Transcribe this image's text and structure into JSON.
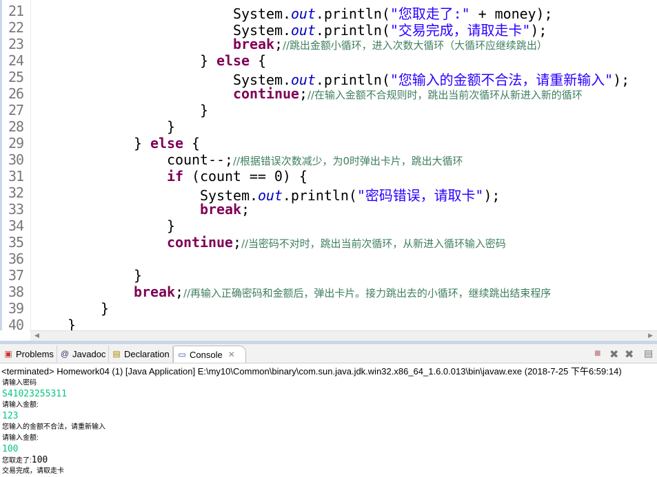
{
  "editor": {
    "line_numbers": [
      "21",
      "22",
      "23",
      "24",
      "25",
      "26",
      "27",
      "28",
      "29",
      "30",
      "31",
      "32",
      "33",
      "34",
      "35",
      "36",
      "37",
      "38",
      "39",
      "40"
    ],
    "lines": [
      {
        "indent": 24,
        "tokens": [
          [
            "p",
            "System."
          ],
          [
            "fld",
            "out"
          ],
          [
            "p",
            ".println("
          ],
          [
            "str",
            "\"您取走了:\""
          ],
          [
            "p",
            " + money);"
          ]
        ]
      },
      {
        "indent": 24,
        "tokens": [
          [
            "p",
            "System."
          ],
          [
            "fld",
            "out"
          ],
          [
            "p",
            ".println("
          ],
          [
            "str",
            "\"交易完成，请取走卡\""
          ],
          [
            "p",
            ");"
          ]
        ]
      },
      {
        "indent": 24,
        "tokens": [
          [
            "kw",
            "break"
          ],
          [
            "p",
            ";"
          ],
          [
            "cm",
            "//跳出金额小循环，进入次数大循环（大循环应继续跳出）"
          ]
        ]
      },
      {
        "indent": 20,
        "tokens": [
          [
            "p",
            "} "
          ],
          [
            "kw",
            "else"
          ],
          [
            "p",
            " {"
          ]
        ]
      },
      {
        "indent": 24,
        "tokens": [
          [
            "p",
            "System."
          ],
          [
            "fld",
            "out"
          ],
          [
            "p",
            ".println("
          ],
          [
            "str",
            "\"您输入的金额不合法，请重新输入\""
          ],
          [
            "p",
            ");"
          ]
        ]
      },
      {
        "indent": 24,
        "tokens": [
          [
            "kw",
            "continue"
          ],
          [
            "p",
            ";"
          ],
          [
            "cm",
            "//在输入金额不合规则时，跳出当前次循环从新进入新的循环"
          ]
        ]
      },
      {
        "indent": 20,
        "tokens": [
          [
            "p",
            "}"
          ]
        ]
      },
      {
        "indent": 16,
        "tokens": [
          [
            "p",
            "}"
          ]
        ]
      },
      {
        "indent": 12,
        "tokens": [
          [
            "p",
            "} "
          ],
          [
            "kw",
            "else"
          ],
          [
            "p",
            " {"
          ]
        ]
      },
      {
        "indent": 16,
        "tokens": [
          [
            "p",
            "count--;"
          ],
          [
            "cm",
            "//根据错误次数减少，为0时弹出卡片，跳出大循环"
          ]
        ]
      },
      {
        "indent": 16,
        "tokens": [
          [
            "kw",
            "if"
          ],
          [
            "p",
            " (count == 0) {"
          ]
        ]
      },
      {
        "indent": 20,
        "tokens": [
          [
            "p",
            "System."
          ],
          [
            "fld",
            "out"
          ],
          [
            "p",
            ".println("
          ],
          [
            "str",
            "\"密码错误，请取卡\""
          ],
          [
            "p",
            ");"
          ]
        ]
      },
      {
        "indent": 20,
        "tokens": [
          [
            "kw",
            "break"
          ],
          [
            "p",
            ";"
          ]
        ]
      },
      {
        "indent": 16,
        "tokens": [
          [
            "p",
            "}"
          ]
        ]
      },
      {
        "indent": 16,
        "tokens": [
          [
            "kw",
            "continue"
          ],
          [
            "p",
            ";"
          ],
          [
            "cm",
            "//当密码不对时，跳出当前次循环，从新进入循环输入密码"
          ]
        ]
      },
      {
        "indent": 0,
        "tokens": []
      },
      {
        "indent": 12,
        "tokens": [
          [
            "p",
            "}"
          ]
        ]
      },
      {
        "indent": 12,
        "tokens": [
          [
            "kw",
            "break"
          ],
          [
            "p",
            ";"
          ],
          [
            "cm",
            "//再输入正确密码和金额后，弹出卡片。接力跳出去的小循环，继续跳出结束程序"
          ]
        ]
      },
      {
        "indent": 8,
        "tokens": [
          [
            "p",
            "}"
          ]
        ]
      },
      {
        "indent": 4,
        "tokens": [
          [
            "p",
            "}"
          ]
        ]
      }
    ]
  },
  "tabs": [
    {
      "label": "Problems",
      "icon": "problems-icon"
    },
    {
      "label": "Javadoc",
      "icon": "javadoc-icon"
    },
    {
      "label": "Declaration",
      "icon": "declaration-icon"
    },
    {
      "label": "Console",
      "icon": "console-icon",
      "active": true
    }
  ],
  "console": {
    "status": "<terminated> Homework04 (1) [Java Application] E:\\my10\\Common\\binary\\com.sun.java.jdk.win32.x86_64_1.6.0.013\\bin\\javaw.exe (2018-7-25 下午6:59:14)",
    "output": [
      {
        "text": "请输入密码",
        "input": false
      },
      {
        "text": "S41023255311",
        "input": true
      },
      {
        "text": "请输入金额:",
        "input": false
      },
      {
        "text": "123",
        "input": true
      },
      {
        "text": "您输入的金额不合法，请重新输入",
        "input": false
      },
      {
        "text": "请输入金额:",
        "input": false
      },
      {
        "text": "100",
        "input": true
      },
      {
        "text": "您取走了:",
        "suffix": "100",
        "input": false
      },
      {
        "text": "交易完成，请取走卡",
        "input": false
      }
    ]
  }
}
